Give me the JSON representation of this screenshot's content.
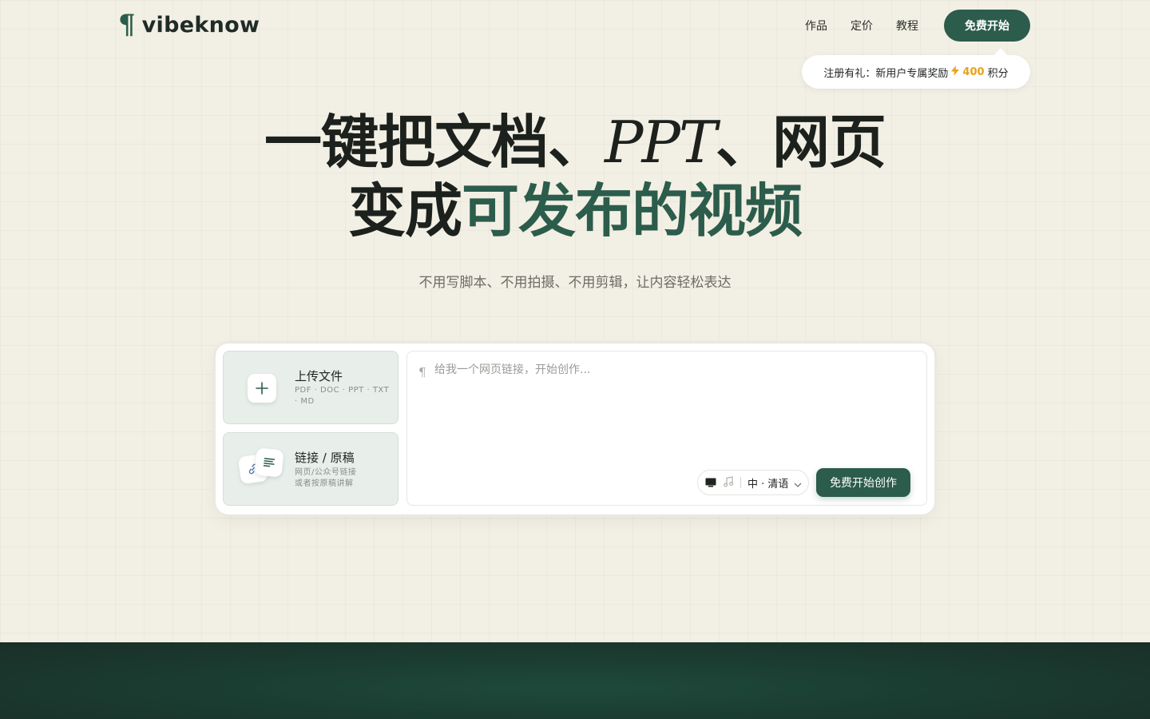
{
  "brand": {
    "logo_mark": "¶",
    "name": "vibeknow",
    "color": "#2c5c4b"
  },
  "nav": {
    "items": [
      "作品",
      "定价",
      "教程"
    ],
    "cta_label": "免费开始"
  },
  "promo": {
    "text": "注册有礼：新用户专属奖励",
    "icon": "lightning-icon",
    "points": "400",
    "unit": "积分"
  },
  "hero": {
    "line1_pre": "一键把文档、",
    "line1_em": "PPT",
    "line1_post": "、网页",
    "line2_plain": "变成",
    "line2_accent": "可发布的视频",
    "subtitle": "不用写脚本、不用拍摄、不用剪辑，让内容轻松表达"
  },
  "panel": {
    "upload": {
      "title": "上传文件",
      "formats": "PDF · DOC · PPT · TXT · MD"
    },
    "link": {
      "title": "链接 / 原稿",
      "desc_line1": "网页/公众号链接",
      "desc_line2": "或者按原稿讲解"
    },
    "editor": {
      "icon": "pilcrow-icon",
      "placeholder": "给我一个网页链接，开始创作..."
    },
    "mode": {
      "icons": [
        "screen-icon",
        "music-icon"
      ],
      "language": "中 · 清语"
    },
    "start_label": "免费开始创作"
  },
  "colors": {
    "background": "#f2efe4",
    "accent": "#2c5c4b",
    "points": "#e8a11c",
    "footer": "#1b3d31"
  }
}
